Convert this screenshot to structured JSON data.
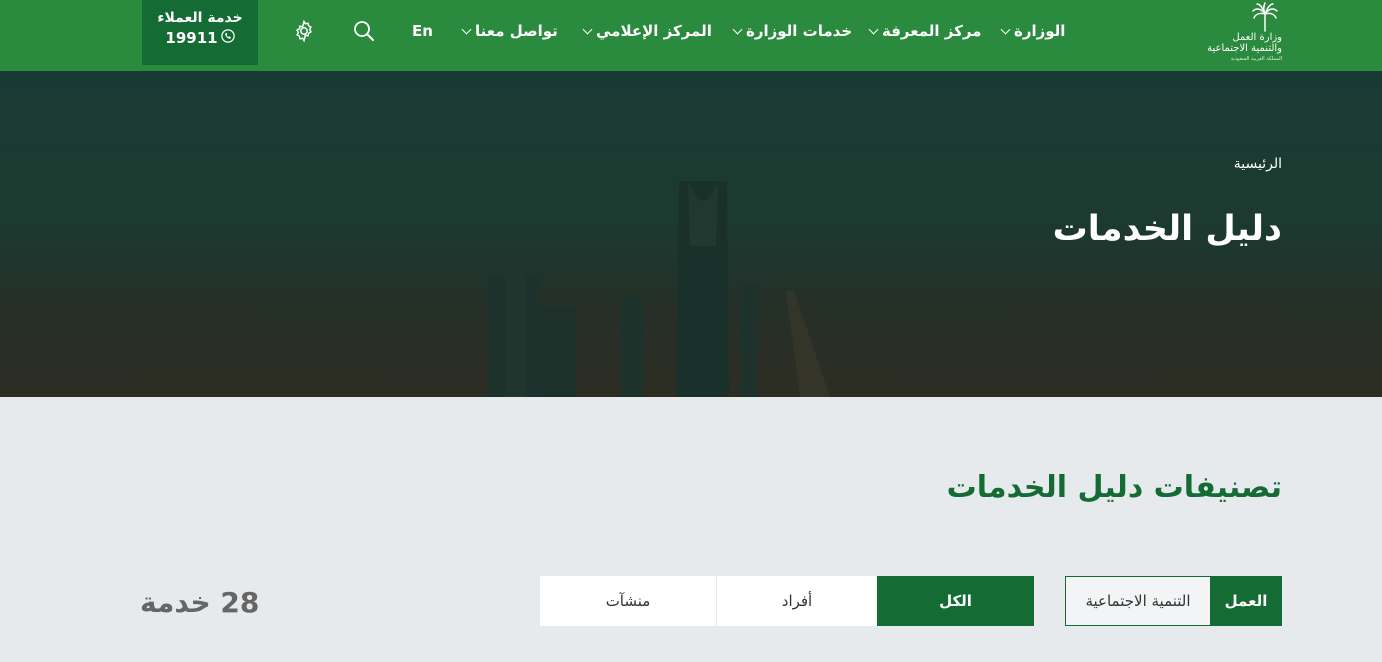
{
  "header": {
    "customer_service": {
      "label": "خدمة العملاء",
      "number": "19911"
    },
    "lang": "En",
    "nav": [
      {
        "label": "الوزارة"
      },
      {
        "label": "مركز المعرفة"
      },
      {
        "label": "خدمات الوزارة"
      },
      {
        "label": "المركز الإعلامي"
      },
      {
        "label": "تواصل معنا"
      }
    ],
    "logo": {
      "line1": "وزارة العمل",
      "line2": "والتنمية الاجتماعية",
      "line3": "المملكة العربية السعودية"
    }
  },
  "hero": {
    "breadcrumb": "الرئيسية",
    "title": "دليل الخدمات"
  },
  "main": {
    "section_title": "تصنيفات دليل الخدمات",
    "count": "28 خدمة",
    "category_tabs": [
      {
        "label": "العمل",
        "active": true
      },
      {
        "label": "التنمية الاجتماعية",
        "active": false
      }
    ],
    "audience_tabs": [
      {
        "label": "الكل",
        "active": true
      },
      {
        "label": "أفراد",
        "active": false
      },
      {
        "label": "منشآت",
        "active": false
      }
    ]
  },
  "colors": {
    "primary": "#2a8a3d",
    "dark_green": "#146b34",
    "page_bg": "#e7eaed"
  },
  "icons": [
    "phone-icon",
    "gear-icon",
    "search-icon",
    "chevron-down-icon",
    "palm-logo-icon"
  ]
}
